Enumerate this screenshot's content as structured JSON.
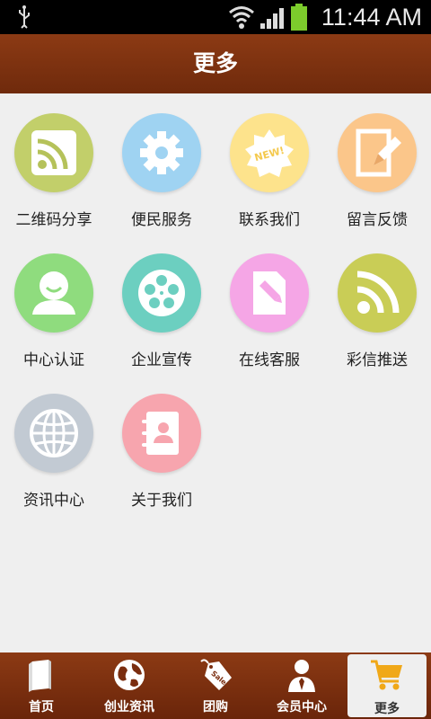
{
  "status_bar": {
    "time": "11:44 AM"
  },
  "header": {
    "title": "更多"
  },
  "grid": [
    {
      "label": "二维码分享",
      "icon": "rss-icon",
      "color": "#c2cf6a"
    },
    {
      "label": "便民服务",
      "icon": "gear-icon",
      "color": "#9fd3f2"
    },
    {
      "label": "联系我们",
      "icon": "new-badge-icon",
      "color": "#fde38c"
    },
    {
      "label": "留言反馈",
      "icon": "edit-note-icon",
      "color": "#fbc68a"
    },
    {
      "label": "中心认证",
      "icon": "user-icon",
      "color": "#8fdc7e"
    },
    {
      "label": "企业宣传",
      "icon": "film-reel-icon",
      "color": "#6ccfc0"
    },
    {
      "label": "在线客服",
      "icon": "pencil-doc-icon",
      "color": "#f5a6e6"
    },
    {
      "label": "彩信推送",
      "icon": "rss-icon",
      "color": "#c9cd56"
    },
    {
      "label": "资讯中心",
      "icon": "globe-icon",
      "color": "#c2cad3"
    },
    {
      "label": "关于我们",
      "icon": "contacts-book-icon",
      "color": "#f7a5ae"
    }
  ],
  "tab_bar": [
    {
      "label": "首页",
      "icon": "book-icon"
    },
    {
      "label": "创业资讯",
      "icon": "globe-icon"
    },
    {
      "label": "团购",
      "icon": "sale-tag-icon"
    },
    {
      "label": "会员中心",
      "icon": "member-icon"
    },
    {
      "label": "更多",
      "icon": "cart-icon",
      "active": true
    }
  ]
}
